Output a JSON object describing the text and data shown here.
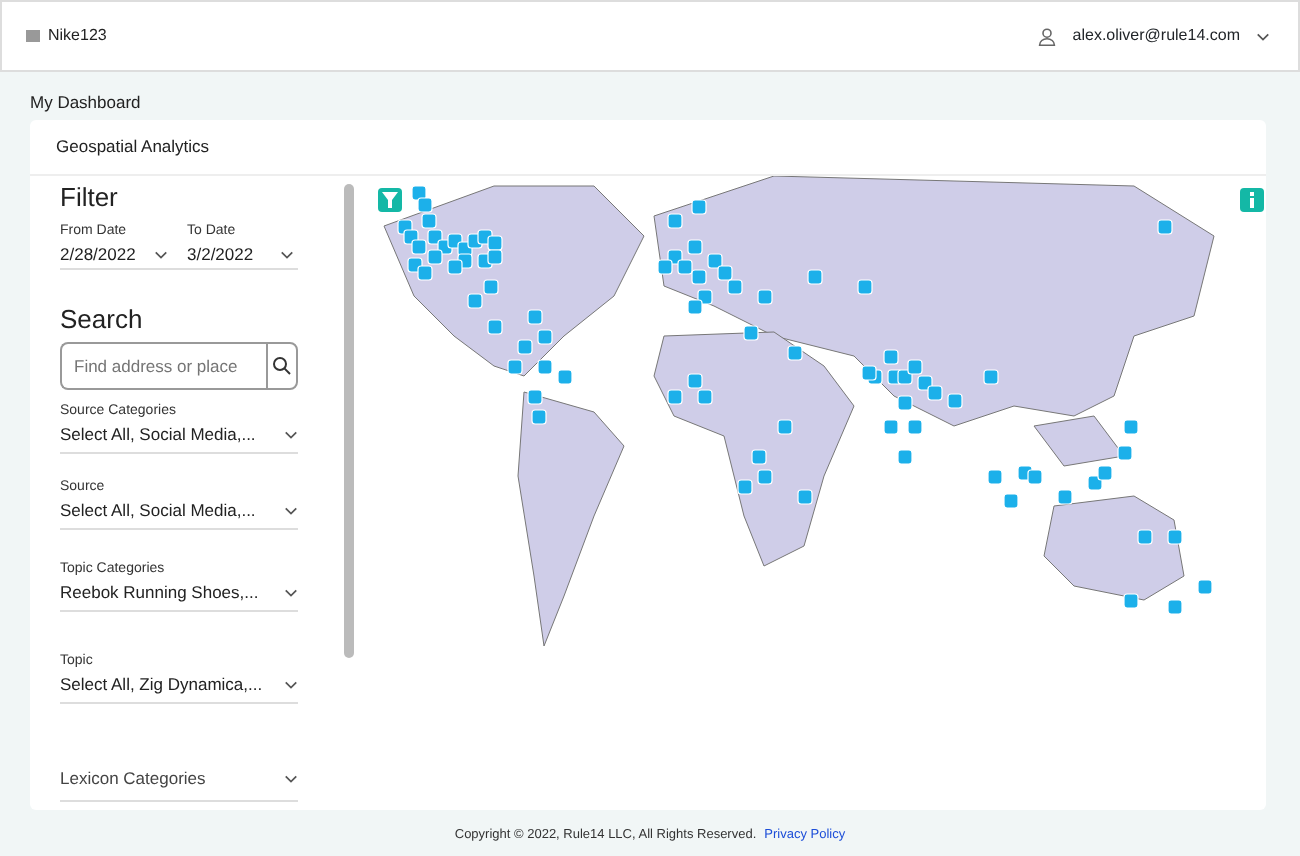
{
  "navbar": {
    "brand": "Nike123",
    "user": "alex.oliver@rule14.com"
  },
  "page_title": "My Dashboard",
  "card": {
    "title": "Geospatial Analytics",
    "filter": {
      "heading": "Filter",
      "dates": [
        {
          "label": "From Date",
          "value": "2/28/2022"
        },
        {
          "label": "To Date",
          "value": "3/2/2022"
        }
      ]
    },
    "search": {
      "heading": "Search",
      "placeholder": "Find address or place"
    },
    "selects": [
      {
        "label": "Source Categories",
        "value": "Select All, Social Media,..."
      },
      {
        "label": "Source",
        "value": "Select All, Social Media,..."
      },
      {
        "label": "Topic Categories",
        "value": "Reebok Running Shoes,..."
      },
      {
        "label": "Topic",
        "value": "Select All, Zig Dynamica,..."
      },
      {
        "placeholder": "Lexicon Categories"
      }
    ]
  },
  "footer": {
    "copyright": "Copyright © 2022, Rule14 LLC, All Rights Reserved.",
    "link": "Privacy Policy"
  }
}
